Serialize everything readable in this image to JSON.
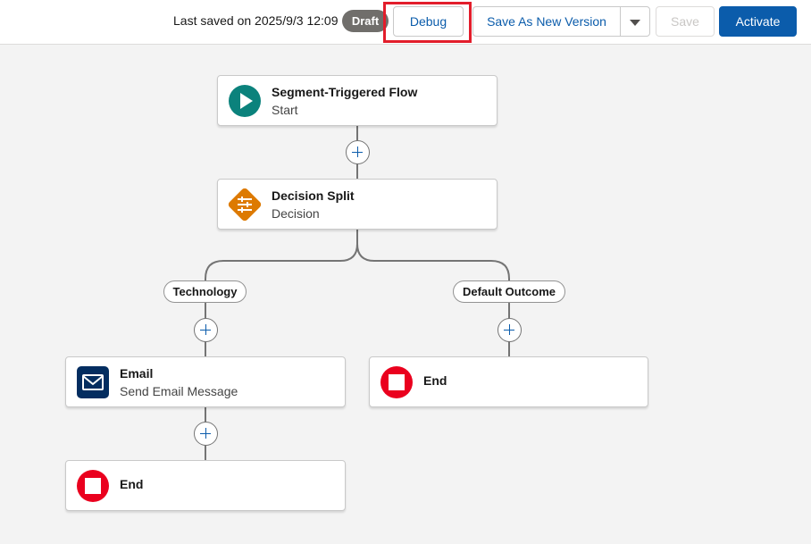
{
  "header": {
    "last_saved": "Last saved on 2025/9/3 12:09",
    "status_badge": "Draft",
    "debug_label": "Debug",
    "save_as_new_label": "Save As New Version",
    "save_label": "Save",
    "activate_label": "Activate"
  },
  "colors": {
    "primary": "#0b5cab",
    "start_icon": "#0b827c",
    "decision_icon": "#dd7a01",
    "email_icon": "#032d60",
    "end_icon": "#ea001e",
    "highlight": "#e21d2b"
  },
  "flow": {
    "start": {
      "title": "Segment-Triggered Flow",
      "subtitle": "Start",
      "icon": "play-icon"
    },
    "decision": {
      "title": "Decision Split",
      "subtitle": "Decision",
      "icon": "decision-icon"
    },
    "branches": [
      {
        "label": "Technology"
      },
      {
        "label": "Default Outcome"
      }
    ],
    "email": {
      "title": "Email",
      "subtitle": "Send Email Message",
      "icon": "envelope-icon"
    },
    "end_label": "End"
  }
}
